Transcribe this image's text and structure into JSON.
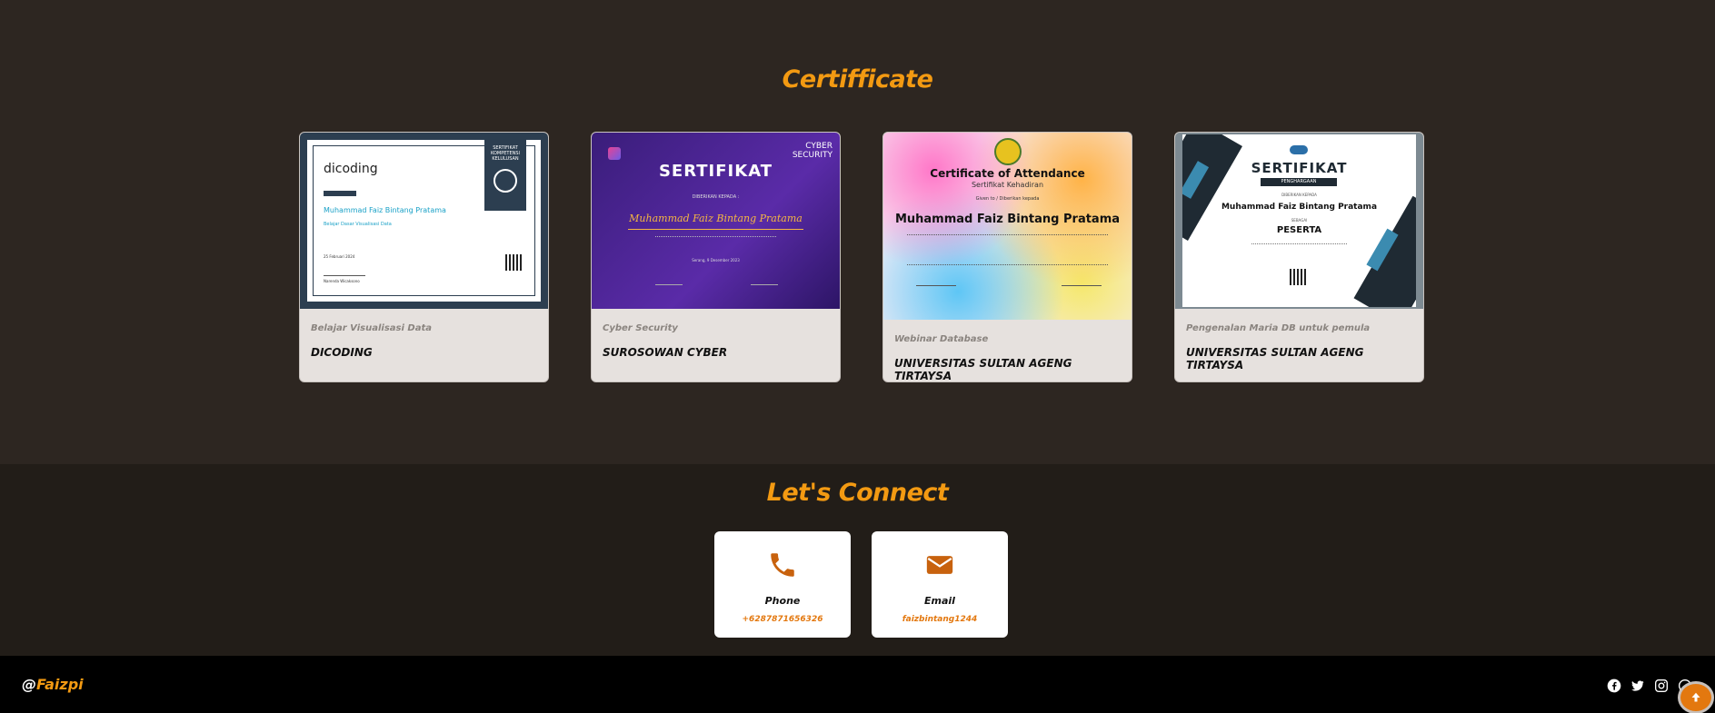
{
  "certificates": {
    "title": "Certifficate",
    "items": [
      {
        "category": "Belajar Visualisasi Data",
        "org": "DICODING",
        "thumb": {
          "logo": "dicoding",
          "badge": "SERTIFIKAT KOMPETENSI KELULUSAN",
          "name": "Muhammad Faiz Bintang Pratama",
          "course": "Belajar Dasar Visualisasi Data",
          "date": "25 Februari 2024",
          "signer": "Narenda Wicaksono"
        }
      },
      {
        "category": "Cyber Security",
        "org": "SUROSOWAN CYBER",
        "thumb": {
          "head": "CYBER SECURITY",
          "heading": "SERTIFIKAT",
          "given": "DIBERIKAN KEPADA :",
          "name": "Muhammad Faiz Bintang Pratama",
          "date": "Serang, 9 Desember 2023"
        }
      },
      {
        "category": "Webinar Database",
        "org": "UNIVERSITAS SULTAN AGENG TIRTAYSA",
        "thumb": {
          "heading": "Certificate of Attendance",
          "sub": "Sertifikat Kehadiran",
          "given": "Given to / Diberikan kepada",
          "name": "Muhammad Faiz Bintang Pratama"
        }
      },
      {
        "category": "Pengenalan Maria DB untuk pemula",
        "org": "UNIVERSITAS SULTAN AGENG TIRTAYSA",
        "thumb": {
          "heading": "SERTIFIKAT",
          "sub": "PENGHARGAAN",
          "given": "DIBERIKAN KEPADA",
          "name": "Muhammad Faiz Bintang Pratama",
          "as": "SEBAGAI",
          "role": "PESERTA"
        }
      }
    ]
  },
  "connect": {
    "title": "Let's Connect",
    "phone": {
      "label": "Phone",
      "value": "+6287871656326",
      "icon": "phone-icon"
    },
    "email": {
      "label": "Email",
      "value": "faizbintang1244",
      "icon": "envelope-icon"
    }
  },
  "footer": {
    "brand_at": "@",
    "brand_name": "Faizpi",
    "social": [
      "facebook-icon",
      "twitter-icon",
      "instagram-icon",
      "whatsapp-icon"
    ]
  },
  "colors": {
    "accent": "#f39a12",
    "accent_dark": "#e3780f",
    "bg": "#2d2621",
    "bg_dark": "#221d18"
  }
}
